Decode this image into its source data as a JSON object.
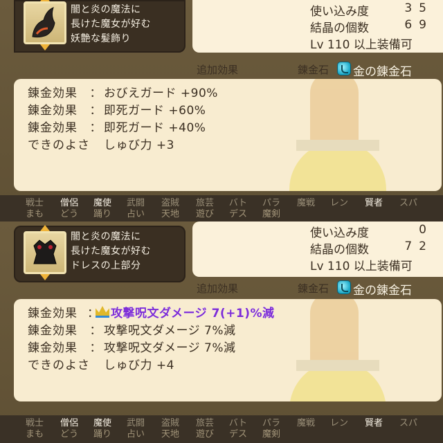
{
  "panels": [
    {
      "item_description": [
        "闇と炎の魔法に",
        "長けた魔女が好む",
        "妖艶な髪飾り"
      ],
      "stats": {
        "usage_label": "使い込み度",
        "usage_value": "35",
        "crystals_label": "結晶の個数",
        "crystals_value": "69",
        "level_requirement": "Lv 110 以上装備可"
      },
      "effect_header": "追加効果",
      "alchemy_stone_label": "錬金石",
      "alchemy_stone_name": "金の錬金石",
      "effects": [
        {
          "key": "錬金効果",
          "value": "おびえガード +90%"
        },
        {
          "key": "錬金効果",
          "value": "即死ガード +60%"
        },
        {
          "key": "錬金効果",
          "value": "即死ガード +40%"
        },
        {
          "key": "できのよさ",
          "value": "しゅび力 +3"
        }
      ],
      "jobs": [
        {
          "l1": "戦士",
          "l2": "まも",
          "usable": false
        },
        {
          "l1": "僧侶",
          "l2": "どう",
          "usable": true
        },
        {
          "l1": "魔使",
          "l2": "踊り",
          "usable": true
        },
        {
          "l1": "武闘",
          "l2": "占い",
          "usable": false
        },
        {
          "l1": "盗賊",
          "l2": "天地",
          "usable": false
        },
        {
          "l1": "旅芸",
          "l2": "遊び",
          "usable": false
        },
        {
          "l1": "バト",
          "l2": "デス",
          "usable": false
        },
        {
          "l1": "パラ",
          "l2": "魔剣",
          "usable": false
        },
        {
          "l1": "魔戦",
          "l2": "",
          "usable": false
        },
        {
          "l1": "レン",
          "l2": "",
          "usable": false
        },
        {
          "l1": "賢者",
          "l2": "",
          "usable": true
        },
        {
          "l1": "スパ",
          "l2": "",
          "usable": false
        }
      ]
    },
    {
      "item_description": [
        "闇と炎の魔法に",
        "長けた魔女が好む",
        "ドレスの上部分"
      ],
      "stats": {
        "usage_label": "使い込み度",
        "usage_value": "0",
        "crystals_label": "結晶の個数",
        "crystals_value": "72",
        "level_requirement": "Lv 110 以上装備可"
      },
      "effect_header": "追加効果",
      "alchemy_stone_label": "錬金石",
      "alchemy_stone_name": "金の錬金石",
      "effects": [
        {
          "key": "錬金効果",
          "value": "攻撃呪文ダメージ 7(+1)%減",
          "special": true
        },
        {
          "key": "錬金効果",
          "value": "攻撃呪文ダメージ 7%減"
        },
        {
          "key": "錬金効果",
          "value": "攻撃呪文ダメージ 7%減"
        },
        {
          "key": "できのよさ",
          "value": "しゅび力 +4"
        }
      ],
      "jobs": [
        {
          "l1": "戦士",
          "l2": "まも",
          "usable": false
        },
        {
          "l1": "僧侶",
          "l2": "どう",
          "usable": true
        },
        {
          "l1": "魔使",
          "l2": "踊り",
          "usable": true
        },
        {
          "l1": "武闘",
          "l2": "占い",
          "usable": false
        },
        {
          "l1": "盗賊",
          "l2": "天地",
          "usable": false
        },
        {
          "l1": "旅芸",
          "l2": "遊び",
          "usable": false
        },
        {
          "l1": "バト",
          "l2": "デス",
          "usable": false
        },
        {
          "l1": "パラ",
          "l2": "魔剣",
          "usable": false
        },
        {
          "l1": "魔戦",
          "l2": "",
          "usable": false
        },
        {
          "l1": "レン",
          "l2": "",
          "usable": false
        },
        {
          "l1": "賢者",
          "l2": "",
          "usable": true
        },
        {
          "l1": "スパ",
          "l2": "",
          "usable": false
        }
      ]
    }
  ]
}
